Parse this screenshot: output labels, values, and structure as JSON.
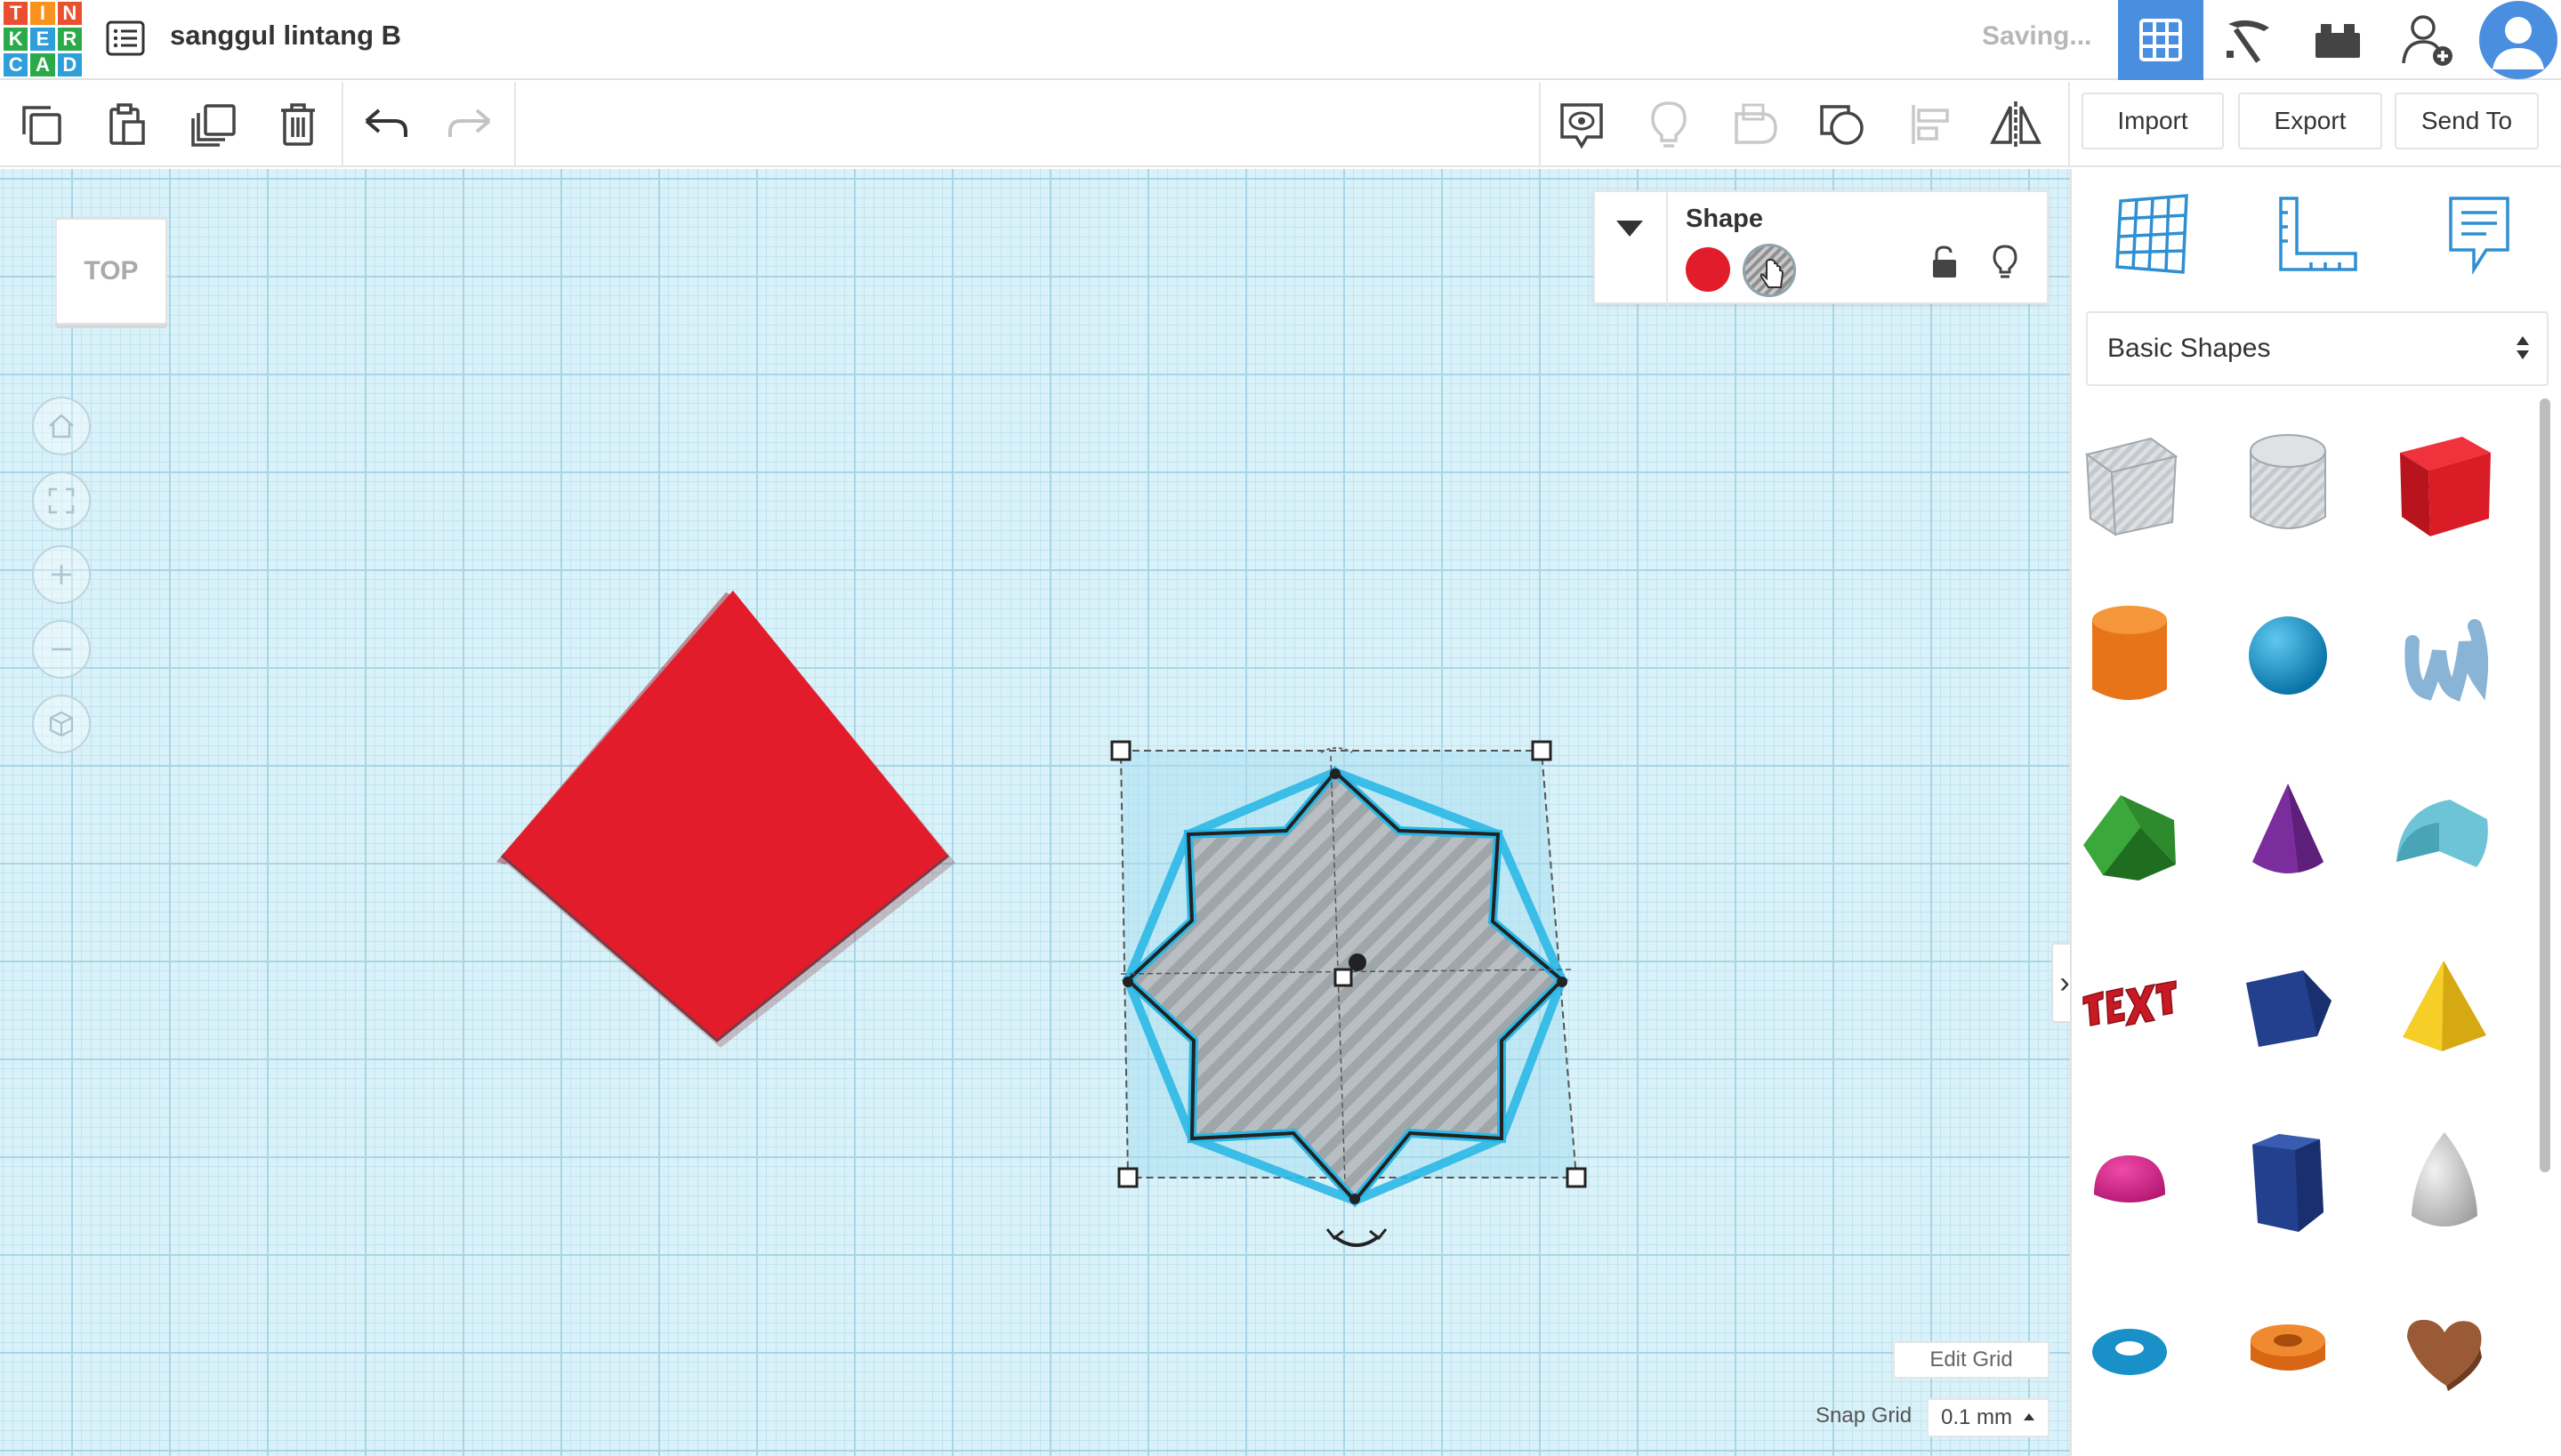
{
  "header": {
    "logo_letters": [
      "T",
      "I",
      "N",
      "K",
      "E",
      "R",
      "C",
      "A",
      "D"
    ],
    "logo_colors": [
      "#e8502f",
      "#f7931e",
      "#e8502f",
      "#2caa4a",
      "#2e9fd8",
      "#2caa4a",
      "#2e9fd8",
      "#2caa4a",
      "#2e9fd8"
    ],
    "design_title": "sanggul lintang B",
    "status": "Saving...",
    "accent": "#4a8ee0"
  },
  "toolbar": {
    "import_label": "Import",
    "export_label": "Export",
    "send_to_label": "Send To"
  },
  "viewcube": {
    "face": "TOP"
  },
  "shape_panel": {
    "title": "Shape",
    "solid_color": "#e21c2a"
  },
  "sidebar": {
    "category": "Basic Shapes",
    "shapes": [
      "box-hole",
      "cylinder-hole",
      "box",
      "cylinder",
      "sphere",
      "scribble",
      "roof",
      "cone",
      "round-roof",
      "text",
      "polygon-prism",
      "pyramid",
      "half-sphere",
      "hexagonal-prism",
      "paraboloid",
      "torus",
      "tube",
      "heart"
    ]
  },
  "grid": {
    "edit_label": "Edit Grid",
    "snap_label": "Snap Grid",
    "snap_value": "0.1 mm"
  }
}
